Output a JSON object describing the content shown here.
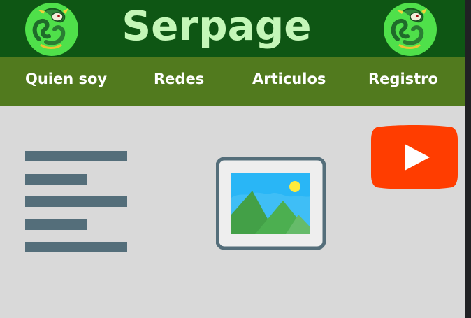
{
  "header": {
    "title": "Serpage",
    "logo_left_icon": "snake-character-logo-icon",
    "logo_right_icon": "snake-character-logo-icon"
  },
  "nav": {
    "items": [
      {
        "label": "Quien soy"
      },
      {
        "label": "Redes"
      },
      {
        "label": "Articulos"
      },
      {
        "label": "Registro"
      }
    ]
  },
  "content": {
    "icons": [
      "text-lines-icon",
      "image-icon",
      "youtube-icon"
    ]
  },
  "colors": {
    "header_bg": "#0e5614",
    "title": "#c4f7b8",
    "nav_bg": "#517a1e",
    "page_bg": "#d9d9d9",
    "youtube": "#ff3d00"
  }
}
